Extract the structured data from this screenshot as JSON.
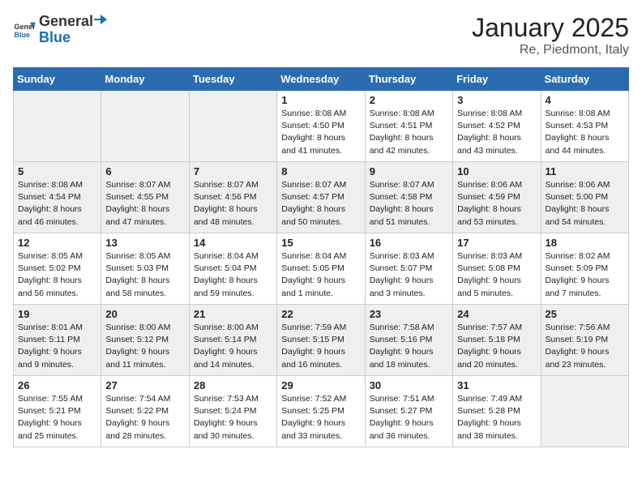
{
  "logo": {
    "general": "General",
    "blue": "Blue"
  },
  "title": "January 2025",
  "subtitle": "Re, Piedmont, Italy",
  "days_of_week": [
    "Sunday",
    "Monday",
    "Tuesday",
    "Wednesday",
    "Thursday",
    "Friday",
    "Saturday"
  ],
  "weeks": [
    [
      {
        "day": "",
        "info": ""
      },
      {
        "day": "",
        "info": ""
      },
      {
        "day": "",
        "info": ""
      },
      {
        "day": "1",
        "info": "Sunrise: 8:08 AM\nSunset: 4:50 PM\nDaylight: 8 hours\nand 41 minutes."
      },
      {
        "day": "2",
        "info": "Sunrise: 8:08 AM\nSunset: 4:51 PM\nDaylight: 8 hours\nand 42 minutes."
      },
      {
        "day": "3",
        "info": "Sunrise: 8:08 AM\nSunset: 4:52 PM\nDaylight: 8 hours\nand 43 minutes."
      },
      {
        "day": "4",
        "info": "Sunrise: 8:08 AM\nSunset: 4:53 PM\nDaylight: 8 hours\nand 44 minutes."
      }
    ],
    [
      {
        "day": "5",
        "info": "Sunrise: 8:08 AM\nSunset: 4:54 PM\nDaylight: 8 hours\nand 46 minutes."
      },
      {
        "day": "6",
        "info": "Sunrise: 8:07 AM\nSunset: 4:55 PM\nDaylight: 8 hours\nand 47 minutes."
      },
      {
        "day": "7",
        "info": "Sunrise: 8:07 AM\nSunset: 4:56 PM\nDaylight: 8 hours\nand 48 minutes."
      },
      {
        "day": "8",
        "info": "Sunrise: 8:07 AM\nSunset: 4:57 PM\nDaylight: 8 hours\nand 50 minutes."
      },
      {
        "day": "9",
        "info": "Sunrise: 8:07 AM\nSunset: 4:58 PM\nDaylight: 8 hours\nand 51 minutes."
      },
      {
        "day": "10",
        "info": "Sunrise: 8:06 AM\nSunset: 4:59 PM\nDaylight: 8 hours\nand 53 minutes."
      },
      {
        "day": "11",
        "info": "Sunrise: 8:06 AM\nSunset: 5:00 PM\nDaylight: 8 hours\nand 54 minutes."
      }
    ],
    [
      {
        "day": "12",
        "info": "Sunrise: 8:05 AM\nSunset: 5:02 PM\nDaylight: 8 hours\nand 56 minutes."
      },
      {
        "day": "13",
        "info": "Sunrise: 8:05 AM\nSunset: 5:03 PM\nDaylight: 8 hours\nand 58 minutes."
      },
      {
        "day": "14",
        "info": "Sunrise: 8:04 AM\nSunset: 5:04 PM\nDaylight: 8 hours\nand 59 minutes."
      },
      {
        "day": "15",
        "info": "Sunrise: 8:04 AM\nSunset: 5:05 PM\nDaylight: 9 hours\nand 1 minute."
      },
      {
        "day": "16",
        "info": "Sunrise: 8:03 AM\nSunset: 5:07 PM\nDaylight: 9 hours\nand 3 minutes."
      },
      {
        "day": "17",
        "info": "Sunrise: 8:03 AM\nSunset: 5:08 PM\nDaylight: 9 hours\nand 5 minutes."
      },
      {
        "day": "18",
        "info": "Sunrise: 8:02 AM\nSunset: 5:09 PM\nDaylight: 9 hours\nand 7 minutes."
      }
    ],
    [
      {
        "day": "19",
        "info": "Sunrise: 8:01 AM\nSunset: 5:11 PM\nDaylight: 9 hours\nand 9 minutes."
      },
      {
        "day": "20",
        "info": "Sunrise: 8:00 AM\nSunset: 5:12 PM\nDaylight: 9 hours\nand 11 minutes."
      },
      {
        "day": "21",
        "info": "Sunrise: 8:00 AM\nSunset: 5:14 PM\nDaylight: 9 hours\nand 14 minutes."
      },
      {
        "day": "22",
        "info": "Sunrise: 7:59 AM\nSunset: 5:15 PM\nDaylight: 9 hours\nand 16 minutes."
      },
      {
        "day": "23",
        "info": "Sunrise: 7:58 AM\nSunset: 5:16 PM\nDaylight: 9 hours\nand 18 minutes."
      },
      {
        "day": "24",
        "info": "Sunrise: 7:57 AM\nSunset: 5:18 PM\nDaylight: 9 hours\nand 20 minutes."
      },
      {
        "day": "25",
        "info": "Sunrise: 7:56 AM\nSunset: 5:19 PM\nDaylight: 9 hours\nand 23 minutes."
      }
    ],
    [
      {
        "day": "26",
        "info": "Sunrise: 7:55 AM\nSunset: 5:21 PM\nDaylight: 9 hours\nand 25 minutes."
      },
      {
        "day": "27",
        "info": "Sunrise: 7:54 AM\nSunset: 5:22 PM\nDaylight: 9 hours\nand 28 minutes."
      },
      {
        "day": "28",
        "info": "Sunrise: 7:53 AM\nSunset: 5:24 PM\nDaylight: 9 hours\nand 30 minutes."
      },
      {
        "day": "29",
        "info": "Sunrise: 7:52 AM\nSunset: 5:25 PM\nDaylight: 9 hours\nand 33 minutes."
      },
      {
        "day": "30",
        "info": "Sunrise: 7:51 AM\nSunset: 5:27 PM\nDaylight: 9 hours\nand 36 minutes."
      },
      {
        "day": "31",
        "info": "Sunrise: 7:49 AM\nSunset: 5:28 PM\nDaylight: 9 hours\nand 38 minutes."
      },
      {
        "day": "",
        "info": ""
      }
    ]
  ]
}
